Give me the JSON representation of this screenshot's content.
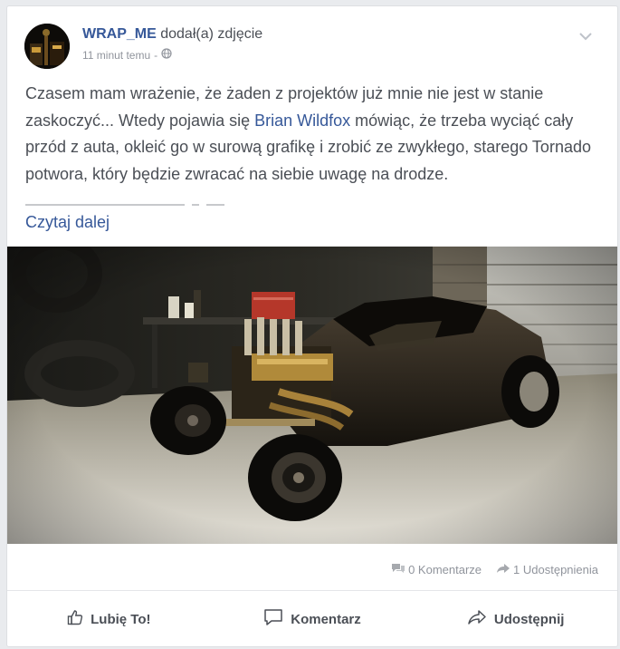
{
  "post": {
    "author": "WRAP_ME",
    "action_text": "dodał(a) zdjęcie",
    "timestamp": "11 minut temu",
    "separator": "-",
    "text_before_mention": "Czasem mam wrażenie, że żaden z projektów już mnie nie jest w stanie zaskoczyć... Wtedy pojawia się ",
    "mention": "Brian Wildfox",
    "text_after_mention": " mówiąc, że trzeba wyciąć cały przód z auta, okleić go w surową grafikę i zrobić ze zwykłego, starego Tornado potwora, który będzie zwracać na siebie uwagę na drodze.",
    "read_more": "Czytaj dalej"
  },
  "stats": {
    "comments": "0 Komentarze",
    "shares": "1 Udostępnienia"
  },
  "actions": {
    "like": "Lubię To!",
    "comment": "Komentarz",
    "share": "Udostępnij"
  },
  "colors": {
    "link": "#365899",
    "text": "#4b4f56",
    "muted": "#90949c"
  },
  "icons": {
    "privacy": "globe-icon",
    "menu": "chevron-down-icon",
    "comments": "comments-icon",
    "shares": "share-arrow-icon",
    "like": "thumbs-up-icon",
    "comment": "speech-bubble-icon",
    "share": "share-icon"
  }
}
